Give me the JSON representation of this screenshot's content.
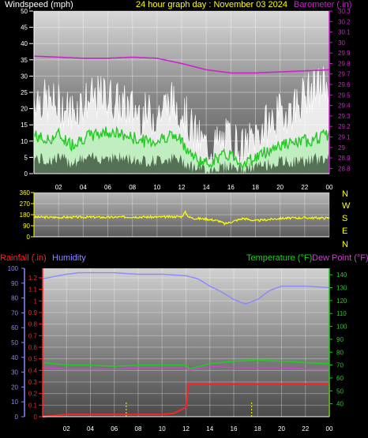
{
  "header": {
    "left_title": "Windspeed (mph)",
    "center_title": "24 hour graph day : November 03 2024",
    "right_title": "Barometer (.in)"
  },
  "compass_labels": [
    "N",
    "W",
    "S",
    "E",
    "N"
  ],
  "lower_header": {
    "rainfall": "Rainfall (.in)",
    "humidity": "Humidity",
    "temperature": "Temperature (°F)",
    "dewpoint": "Dew Point (°F)"
  },
  "colors": {
    "windspeed": "#ffffff",
    "wind_avg": "#22cc22",
    "wind_fill": "#bbeebb",
    "barometer": "#cc22cc",
    "direction": "#ffff00",
    "rainfall": "#ff2222",
    "humidity": "#8888ff",
    "temperature": "#22cc22",
    "dewpoint": "#cc44cc",
    "rain_marker": "#ffff00"
  },
  "chart_data": [
    {
      "type": "line",
      "panel": "wind-barometer",
      "x_ticks": [
        "02",
        "04",
        "06",
        "08",
        "10",
        "12",
        "14",
        "16",
        "18",
        "20",
        "22",
        "00"
      ],
      "xlim": [
        0,
        24
      ],
      "left_ticks": [
        "0",
        "5",
        "10",
        "15",
        "20",
        "25",
        "30",
        "35",
        "40",
        "45",
        "50"
      ],
      "ylim_left": [
        0,
        50
      ],
      "right_ticks": [
        "28.8",
        "28.9",
        "29",
        "29.1",
        "29.2",
        "29.3",
        "29.4",
        "29.5",
        "29.6",
        "29.7",
        "29.8",
        "29.9",
        "30",
        "30.1",
        "30.2",
        "30.3"
      ],
      "ylim_right": [
        28.75,
        30.3
      ],
      "series": [
        {
          "name": "Windspeed (mph)",
          "kind": "gust",
          "x": [
            0,
            1,
            2,
            3,
            4,
            5,
            6,
            7,
            8,
            9,
            10,
            11,
            12,
            13,
            14,
            15,
            16,
            17,
            18,
            19,
            20,
            21,
            22,
            23,
            24
          ],
          "y": [
            24,
            22,
            21,
            19,
            22,
            23,
            24,
            21,
            20,
            18,
            18,
            22,
            20,
            12,
            8,
            9,
            11,
            7,
            12,
            15,
            18,
            20,
            24,
            26,
            28
          ]
        },
        {
          "name": "Windspeed (mph)",
          "kind": "average",
          "x": [
            0,
            1,
            2,
            3,
            4,
            5,
            6,
            7,
            8,
            9,
            10,
            11,
            12,
            13,
            14,
            15,
            16,
            17,
            18,
            19,
            20,
            21,
            22,
            23,
            24
          ],
          "y": [
            12,
            10,
            12,
            9,
            11,
            12,
            13,
            12,
            11,
            10,
            10,
            12,
            10,
            5,
            3,
            5,
            6,
            3,
            5,
            7,
            9,
            9,
            10,
            11,
            12
          ]
        },
        {
          "name": "Barometer (.in)",
          "x": [
            0,
            2,
            4,
            6,
            8,
            10,
            12,
            14,
            16,
            18,
            20,
            22,
            24
          ],
          "y": [
            29.87,
            29.86,
            29.85,
            29.85,
            29.86,
            29.85,
            29.8,
            29.74,
            29.71,
            29.71,
            29.72,
            29.73,
            29.74
          ]
        }
      ]
    },
    {
      "type": "line",
      "panel": "wind-direction",
      "xlim": [
        0,
        24
      ],
      "left_ticks": [
        "0",
        "90",
        "180",
        "270",
        "360"
      ],
      "ylim": [
        0,
        360
      ],
      "series": [
        {
          "name": "Wind direction",
          "x": [
            0,
            2,
            4,
            6,
            8,
            10,
            12,
            12.3,
            12.6,
            13,
            14,
            15,
            15.5,
            16,
            17,
            18,
            19,
            20,
            22,
            24
          ],
          "y": [
            160,
            158,
            160,
            158,
            162,
            160,
            165,
            200,
            160,
            150,
            145,
            130,
            105,
            120,
            150,
            130,
            140,
            150,
            155,
            152
          ]
        }
      ]
    },
    {
      "type": "line",
      "panel": "rain-humidity-temperature",
      "x_ticks": [
        "02",
        "04",
        "06",
        "08",
        "10",
        "12",
        "14",
        "16",
        "18",
        "20",
        "22",
        "00"
      ],
      "xlim": [
        0,
        24
      ],
      "rain_ticks": [
        "0",
        "0.1",
        "0.2",
        "0.3",
        "0.4",
        "0.5",
        "0.6",
        "0.7",
        "0.8",
        "0.9",
        "1",
        "1.1",
        "1.2"
      ],
      "ylim_rain": [
        0,
        1.2
      ],
      "humidity_ticks": [
        "0",
        "10",
        "20",
        "30",
        "40",
        "50",
        "60",
        "70",
        "80",
        "90",
        "100"
      ],
      "ylim_humidity": [
        0,
        100
      ],
      "temp_ticks": [
        "40",
        "50",
        "60",
        "70",
        "80",
        "90",
        "100",
        "110",
        "120",
        "130",
        "140"
      ],
      "ylim_temp": [
        30,
        145
      ],
      "series": [
        {
          "name": "Rainfall (.in)",
          "x": [
            0,
            2,
            4,
            6,
            8,
            10,
            11,
            12,
            12.2,
            14,
            16,
            18,
            20,
            22,
            24
          ],
          "y": [
            0,
            0.02,
            0.02,
            0.02,
            0.02,
            0.02,
            0.03,
            0.08,
            0.28,
            0.28,
            0.28,
            0.28,
            0.28,
            0.28,
            0.28
          ]
        },
        {
          "name": "Humidity",
          "x": [
            0,
            2,
            3,
            4,
            6,
            8,
            10,
            12,
            13,
            14,
            15,
            16,
            17,
            18,
            19,
            20,
            22,
            24
          ],
          "y": [
            93,
            96,
            97,
            97,
            97,
            96,
            96,
            95,
            93,
            88,
            84,
            79,
            76,
            79,
            85,
            88,
            88,
            87
          ]
        },
        {
          "name": "Temperature (°F)",
          "x": [
            0,
            2,
            4,
            6,
            8,
            10,
            12,
            12.3,
            14,
            16,
            18,
            20,
            22,
            24
          ],
          "y": [
            72,
            70,
            70,
            69,
            70,
            70,
            70,
            67,
            71,
            73,
            74,
            73,
            72,
            71
          ]
        },
        {
          "name": "Dew Point (°F)",
          "x": [
            0,
            2,
            4,
            6,
            8,
            10,
            12,
            12.3,
            14,
            16,
            18,
            20,
            22,
            24
          ],
          "y": [
            68,
            67,
            67,
            67,
            68,
            68,
            68,
            66,
            69,
            68,
            68,
            68,
            67,
            67
          ]
        }
      ],
      "rain_markers_x": [
        7,
        17.5
      ]
    }
  ]
}
